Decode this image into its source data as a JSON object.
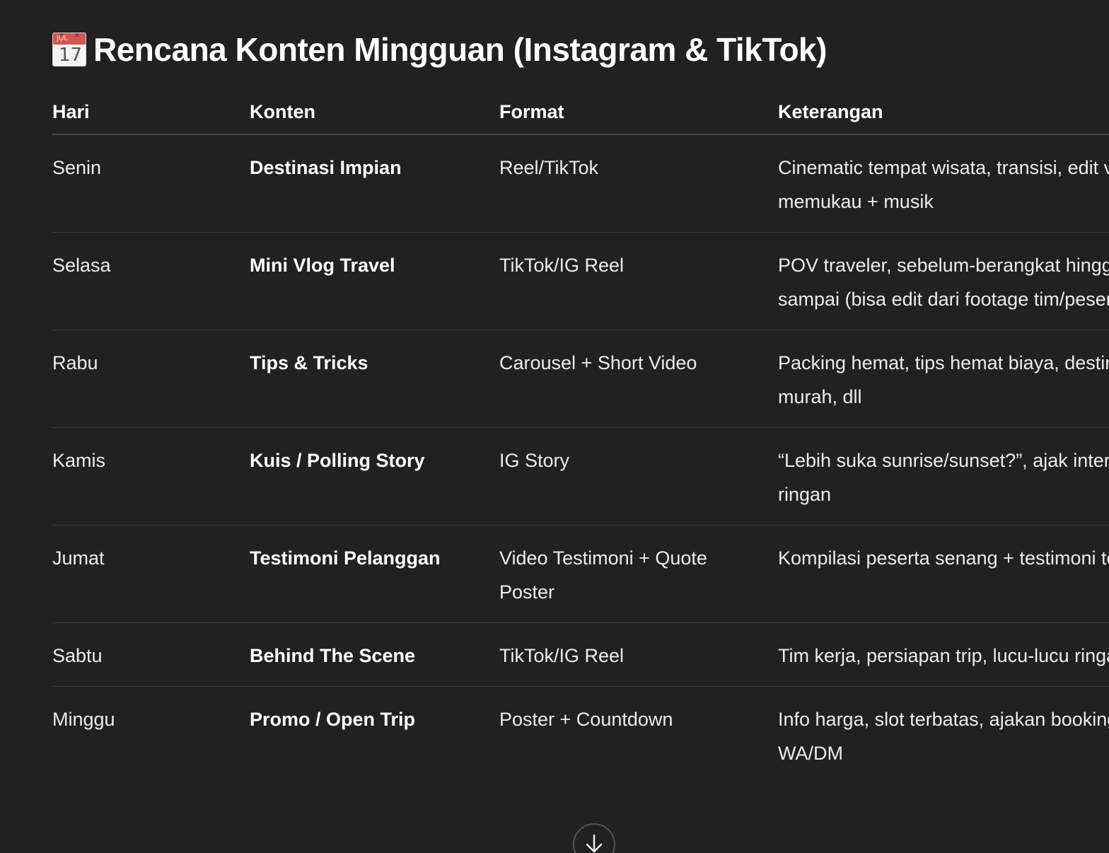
{
  "heading": {
    "icon": "calendar-icon",
    "icon_month": "JUL",
    "icon_day": "17",
    "title": "Rencana Konten Mingguan (Instagram & TikTok)"
  },
  "table": {
    "headers": [
      "Hari",
      "Konten",
      "Format",
      "Keterangan"
    ],
    "rows": [
      {
        "hari": "Senin",
        "konten": "Destinasi Impian",
        "format": "Reel/TikTok",
        "keterangan": "Cinematic tempat wisata, transisi, edit visual memukau + musik"
      },
      {
        "hari": "Selasa",
        "konten": "Mini Vlog Travel",
        "format": "TikTok/IG Reel",
        "keterangan": "POV traveler, sebelum-berangkat hingga sampai (bisa edit dari footage tim/peserta)"
      },
      {
        "hari": "Rabu",
        "konten": "Tips & Tricks",
        "format": "Carousel + Short Video",
        "keterangan": "Packing hemat, tips hemat biaya, destinasi murah, dll"
      },
      {
        "hari": "Kamis",
        "konten": "Kuis / Polling Story",
        "format": "IG Story",
        "keterangan": "“Lebih suka sunrise/sunset?”, ajak interaksi ringan"
      },
      {
        "hari": "Jumat",
        "konten": "Testimoni Pelanggan",
        "format": "Video Testimoni + Quote Poster",
        "keterangan": "Kompilasi peserta senang + testimoni teks"
      },
      {
        "hari": "Sabtu",
        "konten": "Behind The Scene",
        "format": "TikTok/IG Reel",
        "keterangan": "Tim kerja, persiapan trip, lucu-lucu ringan"
      },
      {
        "hari": "Minggu",
        "konten": "Promo / Open Trip",
        "format": "Poster + Countdown",
        "keterangan": "Info harga, slot terbatas, ajakan booking via WA/DM"
      }
    ]
  },
  "scroll_button": {
    "icon": "arrow-down-icon"
  }
}
